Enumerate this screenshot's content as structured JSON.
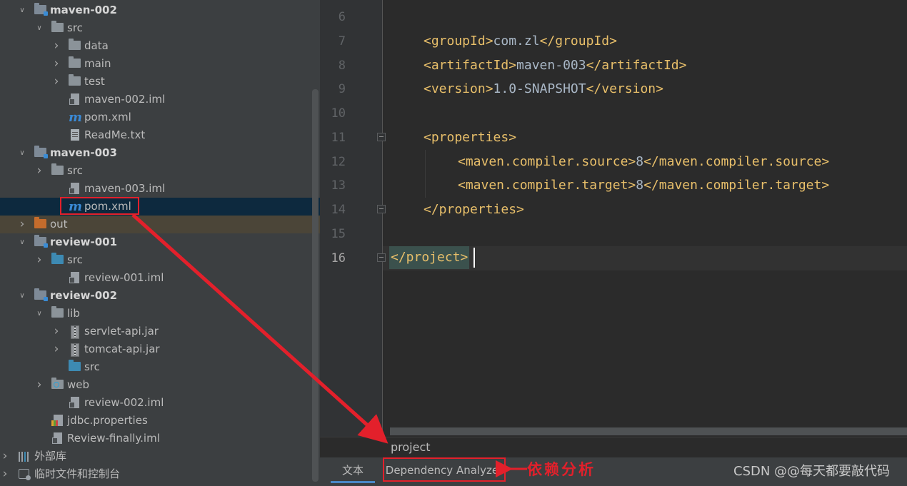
{
  "project_tree": {
    "rows": [
      {
        "label": "maven-002",
        "kind": "module",
        "expanded": "open",
        "bold": true
      },
      {
        "label": "src",
        "kind": "folder",
        "expanded": "open"
      },
      {
        "label": "data",
        "kind": "folder",
        "expanded": "closed"
      },
      {
        "label": "main",
        "kind": "folder",
        "expanded": "closed"
      },
      {
        "label": "test",
        "kind": "folder",
        "expanded": "closed"
      },
      {
        "label": "maven-002.iml",
        "kind": "iml"
      },
      {
        "label": "pom.xml",
        "kind": "maven"
      },
      {
        "label": "ReadMe.txt",
        "kind": "txt"
      },
      {
        "label": "maven-003",
        "kind": "module",
        "expanded": "open",
        "bold": true
      },
      {
        "label": "src",
        "kind": "folder",
        "expanded": "closed"
      },
      {
        "label": "maven-003.iml",
        "kind": "iml"
      },
      {
        "label": "pom.xml",
        "kind": "maven",
        "selected": true
      },
      {
        "label": "out",
        "kind": "out-folder",
        "expanded": "closed"
      },
      {
        "label": "review-001",
        "kind": "module",
        "expanded": "open",
        "bold": true
      },
      {
        "label": "src",
        "kind": "source-folder",
        "expanded": "closed"
      },
      {
        "label": "review-001.iml",
        "kind": "iml"
      },
      {
        "label": "review-002",
        "kind": "module",
        "expanded": "open",
        "bold": true
      },
      {
        "label": "lib",
        "kind": "folder",
        "expanded": "open"
      },
      {
        "label": "servlet-api.jar",
        "kind": "jar",
        "expanded": "closed"
      },
      {
        "label": "tomcat-api.jar",
        "kind": "jar",
        "expanded": "closed"
      },
      {
        "label": "src",
        "kind": "source-folder"
      },
      {
        "label": "web",
        "kind": "web-folder",
        "expanded": "closed"
      },
      {
        "label": "review-002.iml",
        "kind": "iml"
      },
      {
        "label": "jdbc.properties",
        "kind": "properties"
      },
      {
        "label": "Review-finally.iml",
        "kind": "iml"
      },
      {
        "label": "外部库",
        "kind": "library",
        "expanded": "closed"
      },
      {
        "label": "临时文件和控制台",
        "kind": "scratch",
        "expanded": "closed"
      }
    ]
  },
  "editor": {
    "line_numbers": [
      "6",
      "7",
      "8",
      "9",
      "10",
      "11",
      "12",
      "13",
      "14",
      "15",
      "16"
    ],
    "current_line": "16",
    "code": {
      "l7": {
        "open": "<groupId>",
        "value": "com.zl",
        "close": "</groupId>"
      },
      "l8": {
        "open": "<artifactId>",
        "value": "maven-003",
        "close": "</artifactId>"
      },
      "l9": {
        "open": "<version>",
        "value": "1.0-SNAPSHOT",
        "close": "</version>"
      },
      "l11": "<properties>",
      "l12": {
        "open": "<maven.compiler.source>",
        "value": "8",
        "close": "</maven.compiler.source>"
      },
      "l13": {
        "open": "<maven.compiler.target>",
        "value": "8",
        "close": "</maven.compiler.target>"
      },
      "l14": "</properties>",
      "l16": "</project>"
    }
  },
  "breadcrumb": "project",
  "bottom_tabs": {
    "text_tab": "文本",
    "dependency_tab": "Dependency Analyzer"
  },
  "annotation": "依赖分析",
  "watermark": "CSDN @@每天都要敲代码",
  "colors": {
    "highlight_box": "#e3202b",
    "arrow": "#e3202b",
    "tree_background": "#3c3f41",
    "editor_background": "#2b2b2b",
    "xml_tag": "#e8bf6a",
    "xml_text": "#a9b7c6"
  }
}
